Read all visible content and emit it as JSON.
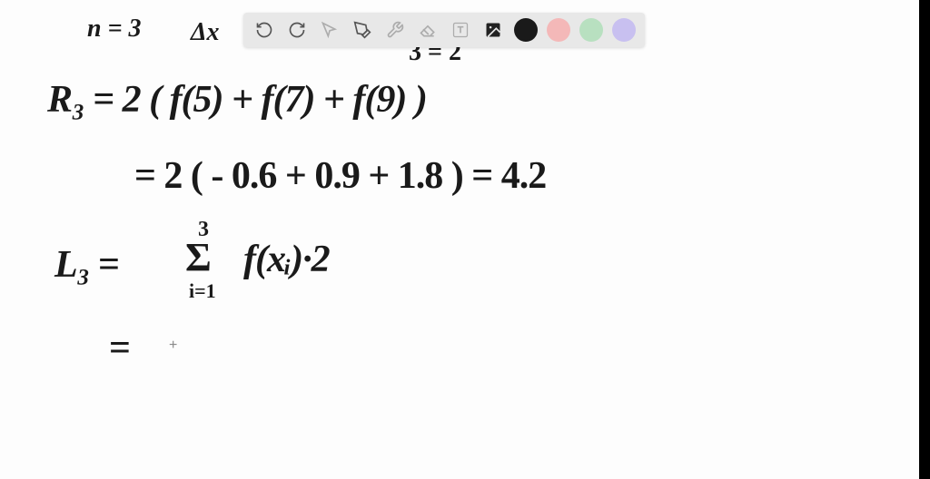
{
  "toolbar": {
    "tools": {
      "undo": "undo",
      "redo": "redo",
      "pointer": "pointer",
      "pen": "pen",
      "tools_wrench": "tools",
      "eraser": "eraser",
      "text": "text",
      "image": "image"
    },
    "colors": {
      "black": "#1a1a1a",
      "pink": "#f4b8b8",
      "green": "#b8e0c0",
      "purple": "#c8c0f0"
    }
  },
  "handwriting": {
    "line1a": "n = 3",
    "line1b": "Δx",
    "line1c_frag": "3  =  2",
    "line2": "R₃ = 2 ( f(5) + f(7) + f(9) )",
    "line3": "= 2 ( - 0.6 + 0.9 + 1.8 ) = 4.2",
    "line4a": "L₃ =",
    "line4_sum_top": "3",
    "line4_sum_sigma": "Σ",
    "line4_sum_bot": "i=1",
    "line4b": "f(xᵢ)·2",
    "line5": "="
  }
}
